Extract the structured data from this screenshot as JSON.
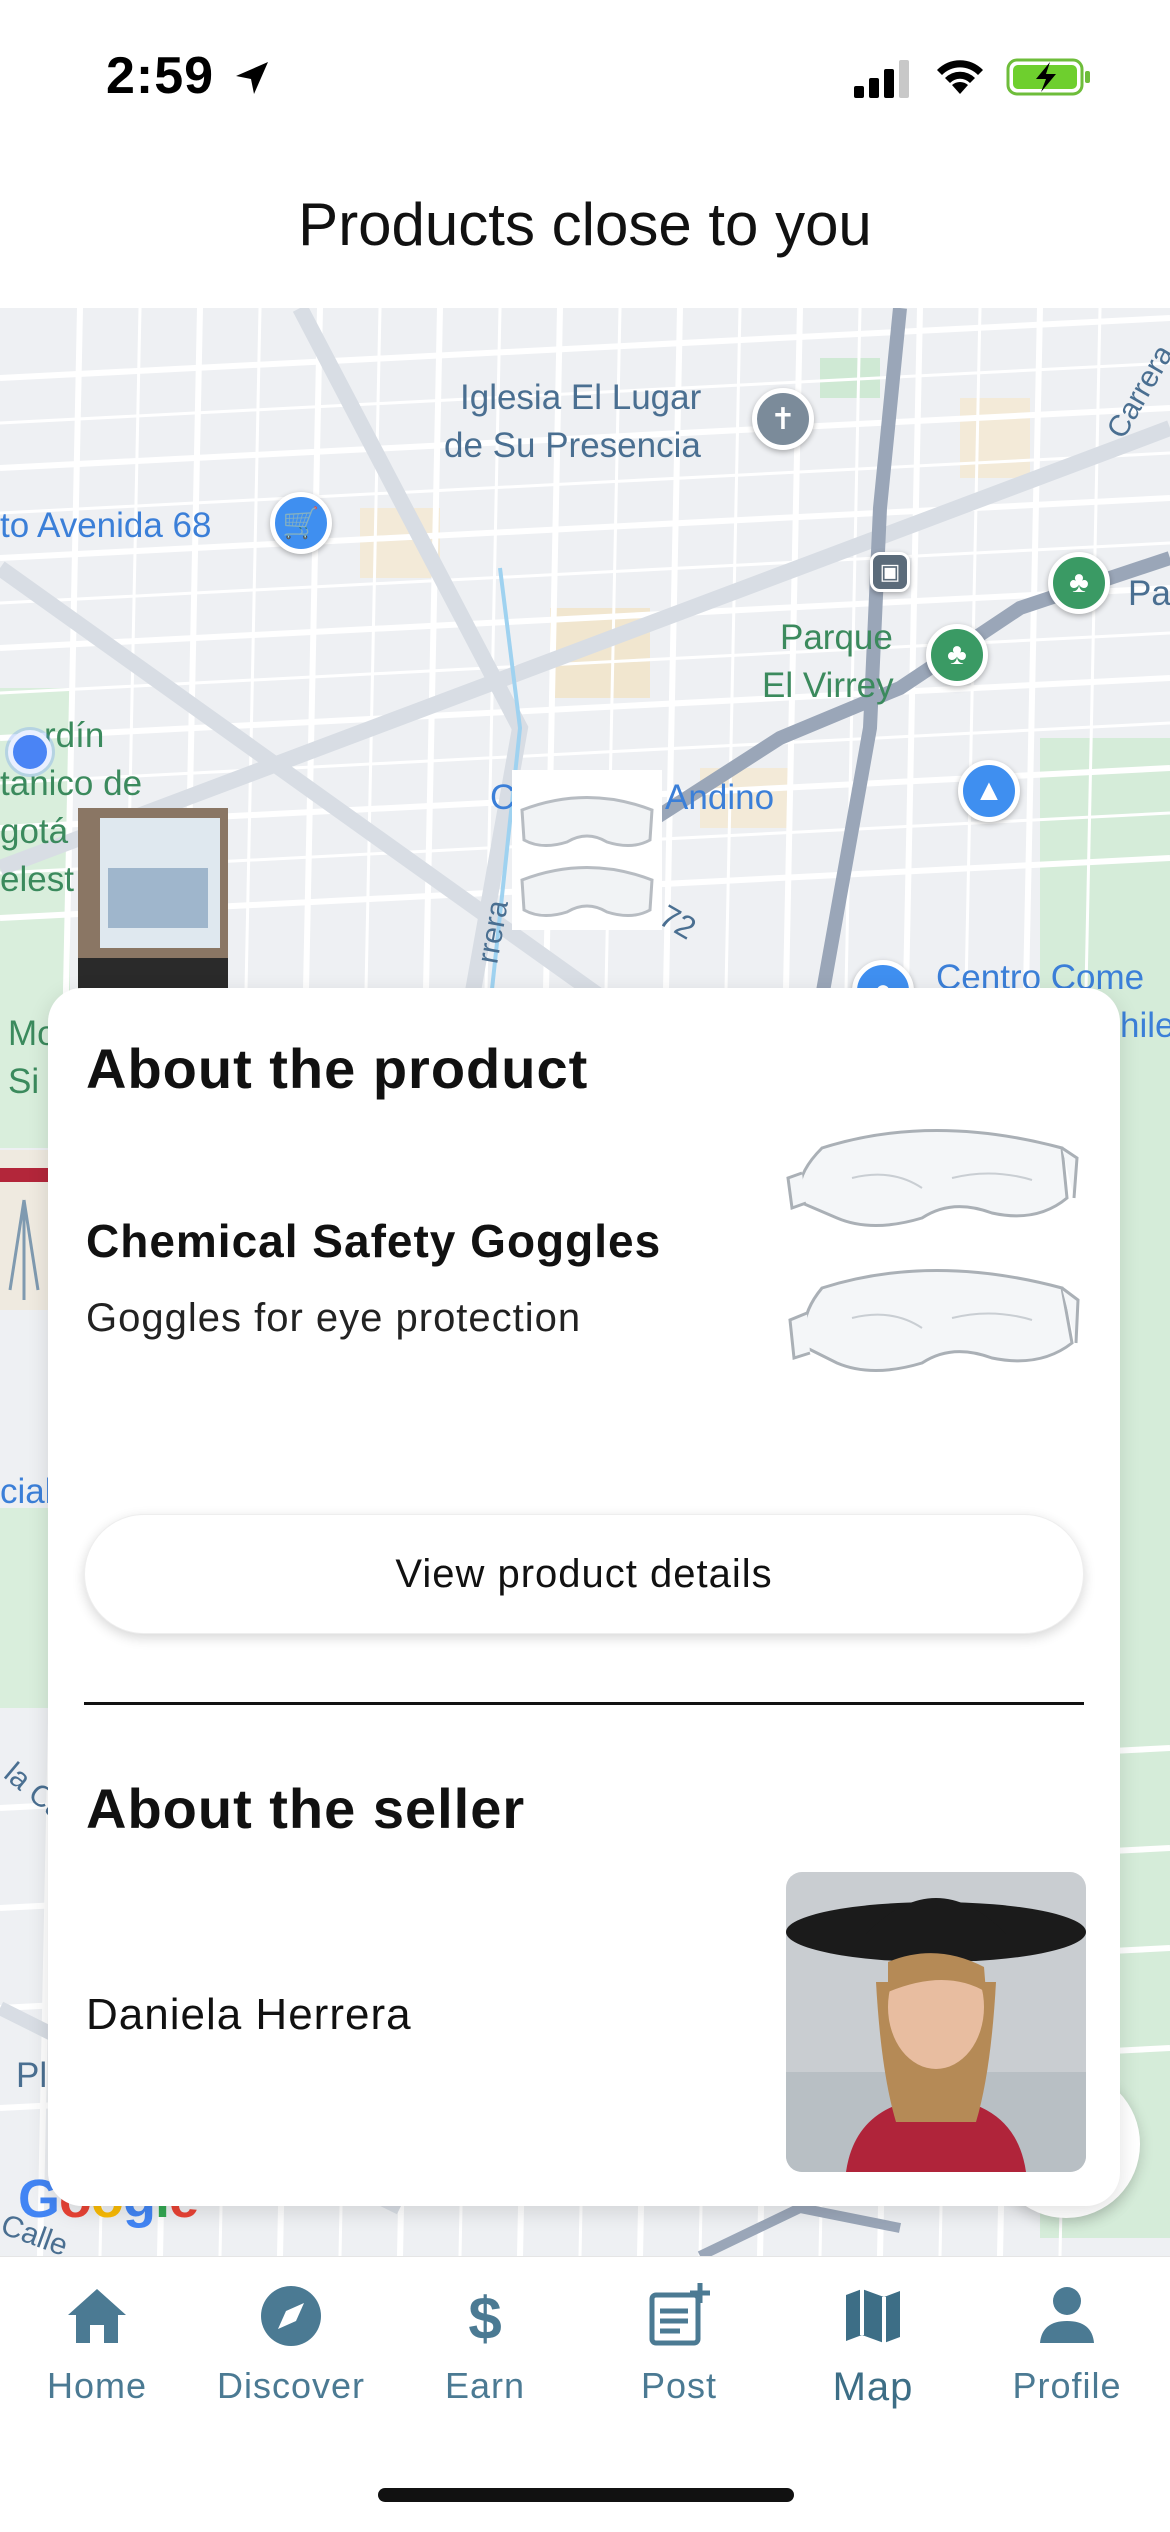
{
  "status_bar": {
    "time": "2:59"
  },
  "header": {
    "title": "Products close to you"
  },
  "map": {
    "labels": {
      "iglesia_1": "Iglesia El Lugar",
      "iglesia_2": "de Su Presencia",
      "avenida": "to Avenida 68",
      "parque_1": "Parque",
      "parque_2": "El Virrey",
      "jardin_1": "rdín",
      "jardin_2": "tanico de",
      "jardin_3": "gotá",
      "jardin_4": "elest",
      "andino": "C   omercial Andino",
      "centro_1": "Centro Come",
      "centro_2": "hile",
      "carrera": "Carrera",
      "carrera_left": "rrera",
      "street_72": "72",
      "pa": "Pa",
      "mo": "Mo",
      "si": "Si",
      "cial": "cial",
      "la_ca": "la Ca",
      "pl": "Pl",
      "calle": "Calle"
    },
    "google_logo": "Google"
  },
  "product_card": {
    "section_title": "About the product",
    "product_name": "Chemical Safety Goggles",
    "product_description": "Goggles for eye protection",
    "details_button": "View product details",
    "seller_section_title": "About the seller",
    "seller_name": "Daniela Herrera"
  },
  "bottom_nav": {
    "items": [
      {
        "label": "Home",
        "icon": "home-icon"
      },
      {
        "label": "Discover",
        "icon": "compass-icon"
      },
      {
        "label": "Earn",
        "icon": "dollar-icon"
      },
      {
        "label": "Post",
        "icon": "post-icon"
      },
      {
        "label": "Map",
        "icon": "map-icon"
      },
      {
        "label": "Profile",
        "icon": "profile-icon"
      }
    ],
    "active": "Map"
  },
  "colors": {
    "accent": "#4b7a93",
    "map_background": "#eef0f3",
    "pin_blue": "#3f8ff0",
    "pin_green": "#3a9a64"
  }
}
